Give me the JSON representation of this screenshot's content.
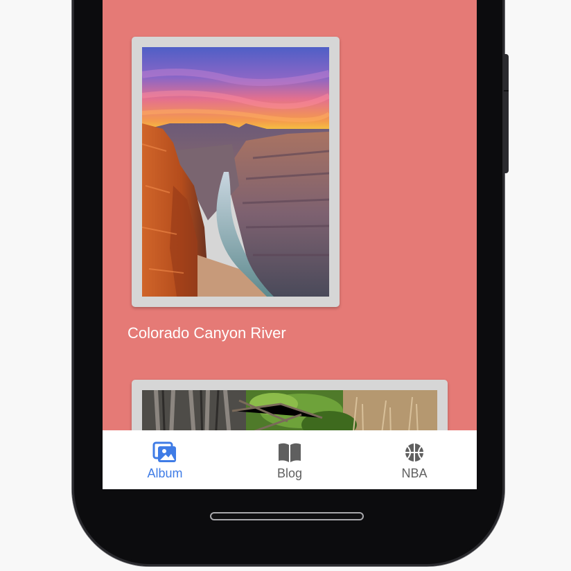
{
  "colors": {
    "screen_background": "#e57a76",
    "tab_active": "#3f7ce6",
    "tab_inactive": "#5f5f5f",
    "card_frame": "#d6d6d6"
  },
  "album": {
    "items": [
      {
        "title": "Colorado Canyon River",
        "image": "canyon-river-photo"
      },
      {
        "title": "",
        "image": "forest-branches-photo"
      }
    ]
  },
  "tabbar": {
    "tabs": [
      {
        "label": "Album",
        "icon": "photo-album-icon",
        "active": true
      },
      {
        "label": "Blog",
        "icon": "open-book-icon",
        "active": false
      },
      {
        "label": "NBA",
        "icon": "basketball-icon",
        "active": false
      }
    ]
  }
}
